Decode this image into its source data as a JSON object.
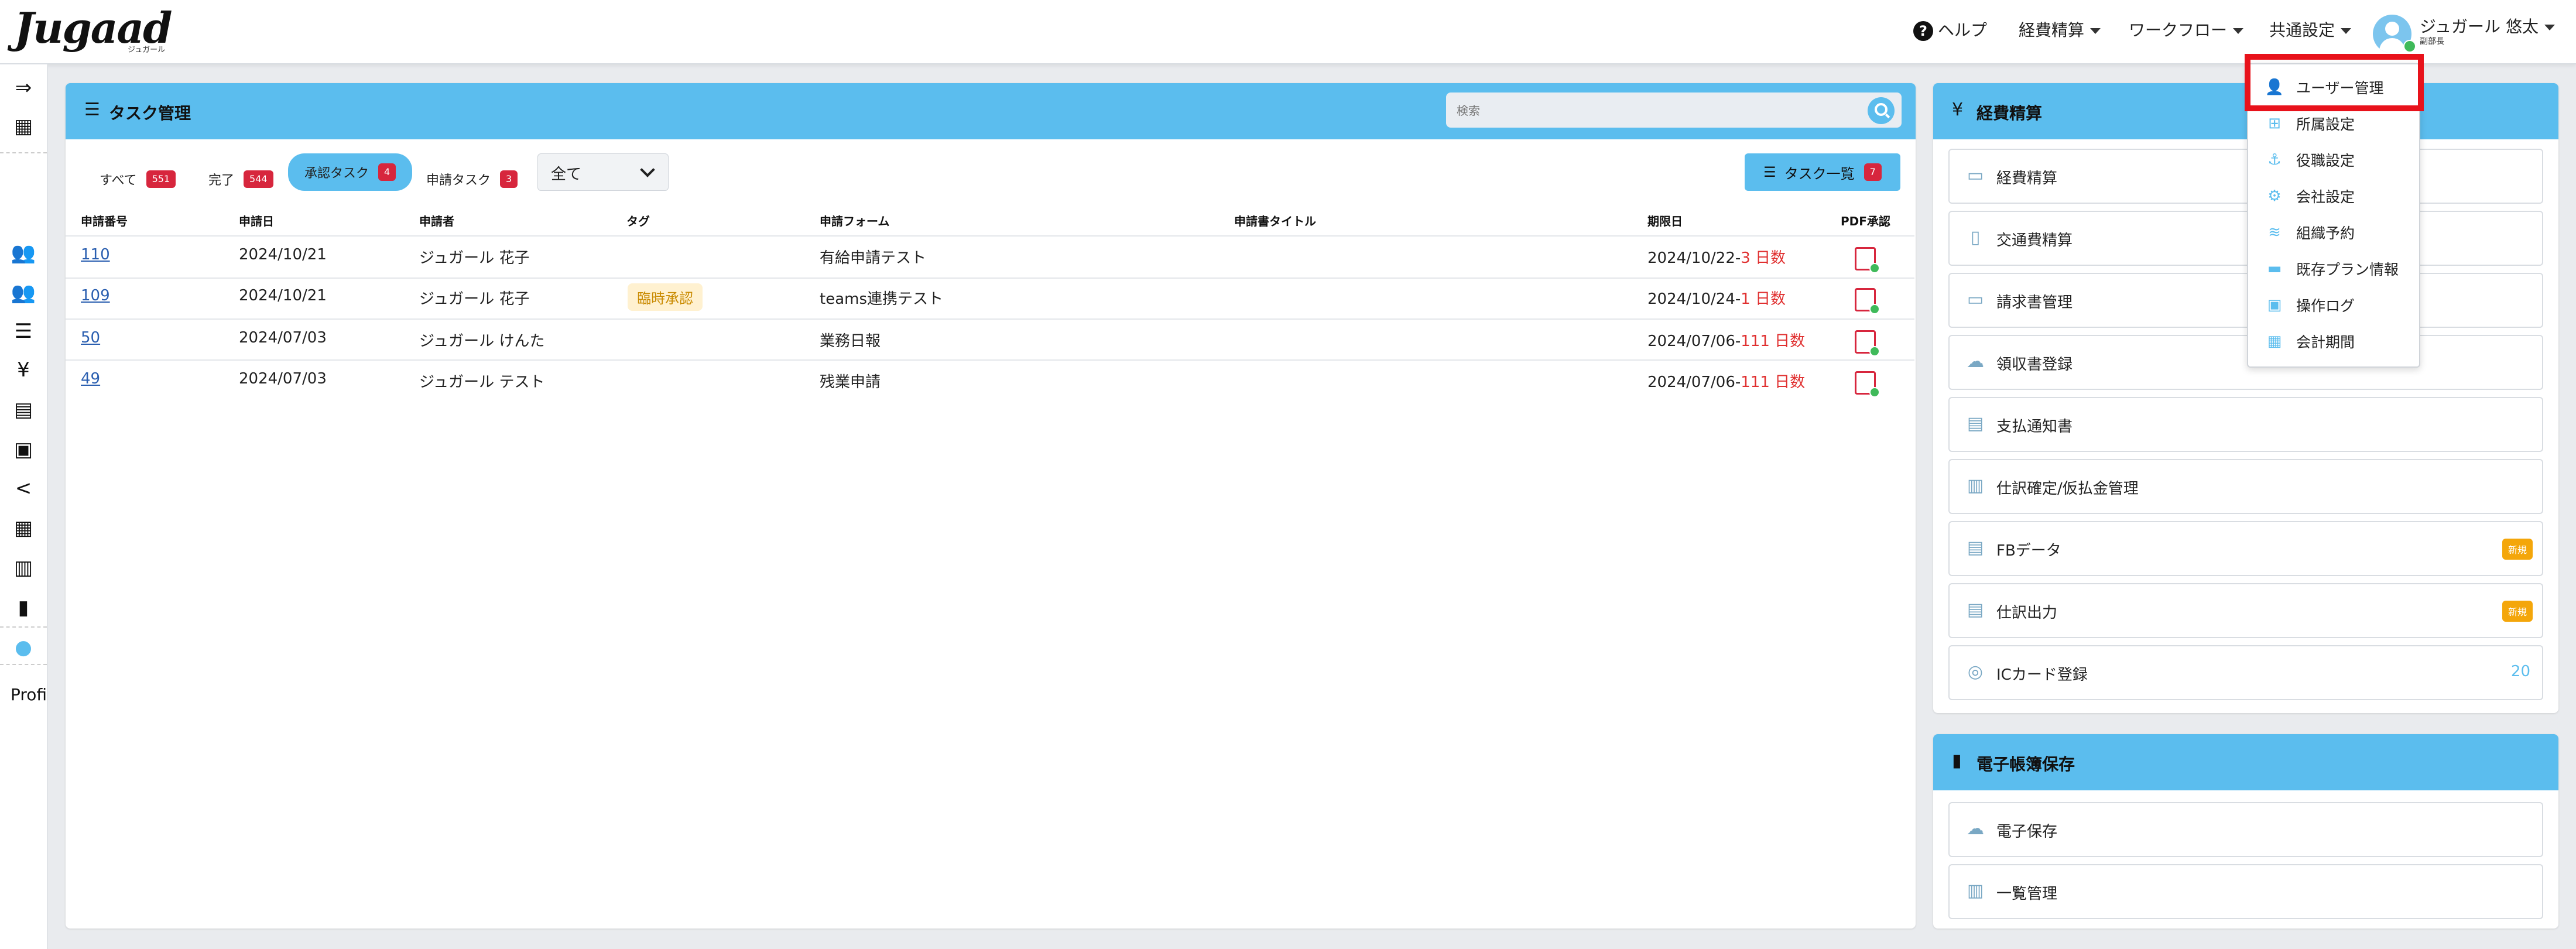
{
  "header": {
    "logo": "Jugaad",
    "logo_sub": "ジュガール",
    "help": "ヘルプ",
    "nav": [
      "経費精算",
      "ワークフロー",
      "共通設定"
    ],
    "user_name": "ジュガール 悠太",
    "user_role": "副部長"
  },
  "sidebar": {
    "bottom_text": "Profi"
  },
  "task_panel": {
    "title": "タスク管理",
    "search_placeholder": "検索",
    "tabs": [
      {
        "label": "すべて",
        "count": "551"
      },
      {
        "label": "完了",
        "count": "544"
      },
      {
        "label": "承認タスク",
        "count": "4"
      },
      {
        "label": "申請タスク",
        "count": "3"
      }
    ],
    "select_value": "全て",
    "task_list_button": {
      "label": "タスク一覧",
      "count": "7"
    },
    "columns": [
      "申請番号",
      "申請日",
      "申請者",
      "タグ",
      "申請フォーム",
      "申請書タイトル",
      "期限日",
      "PDF承認"
    ],
    "rows": [
      {
        "id": "110",
        "date": "2024/10/21",
        "applicant": "ジュガール 花子",
        "tag": "",
        "form": "有給申請テスト",
        "title": "",
        "due": "2024/10/22-",
        "days": "3 日数"
      },
      {
        "id": "109",
        "date": "2024/10/21",
        "applicant": "ジュガール 花子",
        "tag": "臨時承認",
        "form": "teams連携テスト",
        "title": "",
        "due": "2024/10/24-",
        "days": "1 日数"
      },
      {
        "id": "50",
        "date": "2024/07/03",
        "applicant": "ジュガール けんた",
        "tag": "",
        "form": "業務日報",
        "title": "",
        "due": "2024/07/06-",
        "days": "111 日数"
      },
      {
        "id": "49",
        "date": "2024/07/03",
        "applicant": "ジュガール テスト",
        "tag": "",
        "form": "残業申請",
        "title": "",
        "due": "2024/07/06-",
        "days": "111 日数"
      }
    ]
  },
  "expense_panel": {
    "title": "経費精算",
    "items": [
      {
        "label": "経費精算",
        "badge": "",
        "count": ""
      },
      {
        "label": "交通費精算",
        "badge": "",
        "count": ""
      },
      {
        "label": "請求書管理",
        "badge": "",
        "count": ""
      },
      {
        "label": "領収書登録",
        "badge": "",
        "count": ""
      },
      {
        "label": "支払通知書",
        "badge": "",
        "count": ""
      },
      {
        "label": "仕訳確定/仮払金管理",
        "badge": "",
        "count": ""
      },
      {
        "label": "FBデータ",
        "badge": "新規",
        "count": ""
      },
      {
        "label": "仕訳出力",
        "badge": "新規",
        "count": ""
      },
      {
        "label": "ICカード登録",
        "badge": "",
        "count": "20"
      }
    ]
  },
  "ebook_panel": {
    "title": "電子帳簿保存",
    "items": [
      {
        "label": "電子保存"
      },
      {
        "label": "一覧管理"
      }
    ]
  },
  "dropdown": {
    "items": [
      "ユーザー管理",
      "所属設定",
      "役職設定",
      "会社設定",
      "組織予約",
      "既存プラン情報",
      "操作ログ",
      "会計期間"
    ]
  },
  "colors": {
    "accent": "#5bbdee",
    "badge_red": "#d7263d",
    "highlight": "#e8121b",
    "new_badge": "#f4a60a"
  }
}
